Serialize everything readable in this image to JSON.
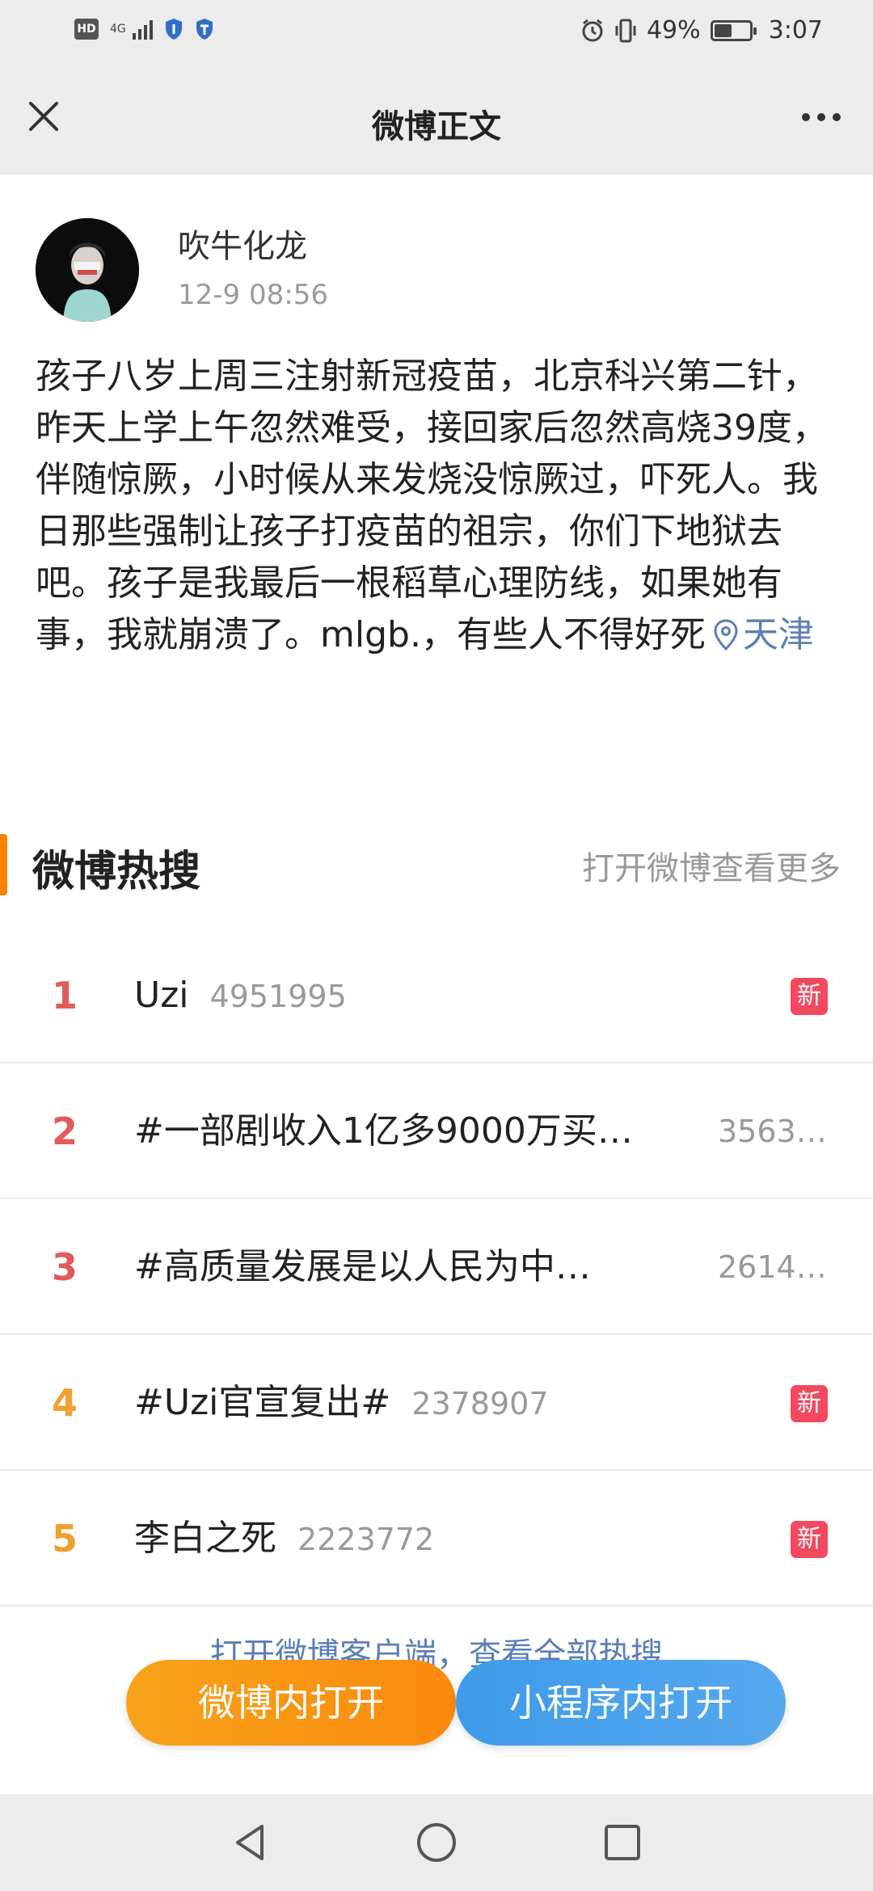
{
  "status_bar": {
    "hd": "HD",
    "network": "4G",
    "battery_percent": "49%",
    "battery_level": 0.49,
    "time": "3:07"
  },
  "header": {
    "title": "微博正文"
  },
  "post": {
    "username": "吹牛化龙",
    "time": "12-9 08:56",
    "text": "孩子八岁上周三注射新冠疫苗，北京科兴第二针，昨天上学上午忽然难受，接回家后忽然高烧39度，伴随惊厥，小时候从来发烧没惊厥过，吓死人。我日那些强制让孩子打疫苗的祖宗，你们下地狱去吧。孩子是我最后一根稻草心理防线，如果她有事，我就崩溃了。mlgb.，有些人不得好死",
    "location": "天津"
  },
  "hot_search": {
    "title": "微博热搜",
    "more": "打开微博查看更多",
    "items": [
      {
        "rank": "1",
        "topic": "Uzi",
        "count": "4951995",
        "badge": "新",
        "rank_color": "#e25b5b"
      },
      {
        "rank": "2",
        "topic": "#一部剧收入1亿多9000万买…",
        "count": "3563…",
        "badge": "",
        "rank_color": "#e25b5b"
      },
      {
        "rank": "3",
        "topic": "#高质量发展是以人民为中…",
        "count": "2614…",
        "badge": "",
        "rank_color": "#e25b5b"
      },
      {
        "rank": "4",
        "topic": "#Uzi官宣复出#",
        "count": "2378907",
        "badge": "新",
        "rank_color": "#f0a030"
      },
      {
        "rank": "5",
        "topic": "李白之死",
        "count": "2223772",
        "badge": "新",
        "rank_color": "#f0a030"
      }
    ],
    "open_client": "打开微博客户端，查看全部热搜"
  },
  "buttons": {
    "open_in_weibo": "微博内打开",
    "open_in_mini_program": "小程序内打开"
  },
  "icons": {
    "close": "close-icon",
    "more": "more-dots-icon",
    "location": "location-pin-icon",
    "nav_back": "back-triangle-icon",
    "nav_home": "home-circle-icon",
    "nav_recent": "recent-square-icon"
  }
}
